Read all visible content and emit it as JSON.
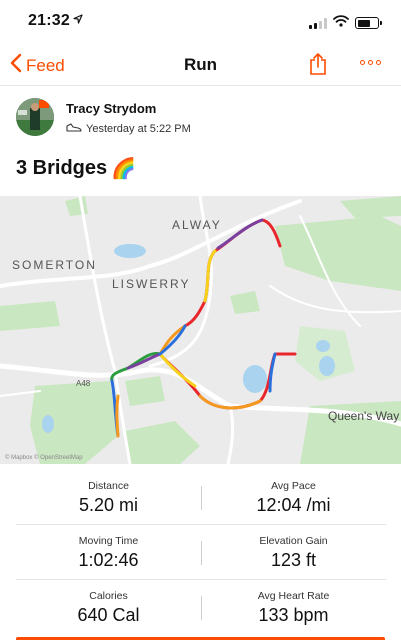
{
  "status_bar": {
    "time": "21:32",
    "location_arrow": "location-arrow-icon"
  },
  "nav": {
    "back_label": "Feed",
    "title": "Run"
  },
  "athlete": {
    "name": "Tracy Strydom",
    "timestamp": "Yesterday at 5:22 PM"
  },
  "activity": {
    "title": "3 Bridges",
    "emoji": "🌈"
  },
  "map": {
    "places": {
      "alway": "ALWAY",
      "somerton": "SOMERTON",
      "liswerry": "LISWERRY",
      "a48": "A48",
      "queens_way": "Queen's Way"
    },
    "attribution": "© Mapbox © OpenStreetMap"
  },
  "stats": [
    {
      "left_label": "Distance",
      "left_value": "5.20 mi",
      "right_label": "Avg Pace",
      "right_value": "12:04 /mi"
    },
    {
      "left_label": "Moving Time",
      "left_value": "1:02:46",
      "right_label": "Elevation Gain",
      "right_value": "123 ft"
    },
    {
      "left_label": "Calories",
      "left_value": "640 Cal",
      "right_label": "Avg Heart Rate",
      "right_value": "133 bpm"
    }
  ],
  "colors": {
    "accent": "#fc4c02",
    "map_bg": "#ecebeb",
    "park": "#c9e7c0",
    "water": "#a9d3ee"
  },
  "icons": [
    "location-arrow-icon",
    "signal-icon",
    "wifi-icon",
    "battery-icon",
    "chevron-left-icon",
    "share-icon",
    "more-icon",
    "shoe-icon",
    "rainbow-emoji"
  ]
}
